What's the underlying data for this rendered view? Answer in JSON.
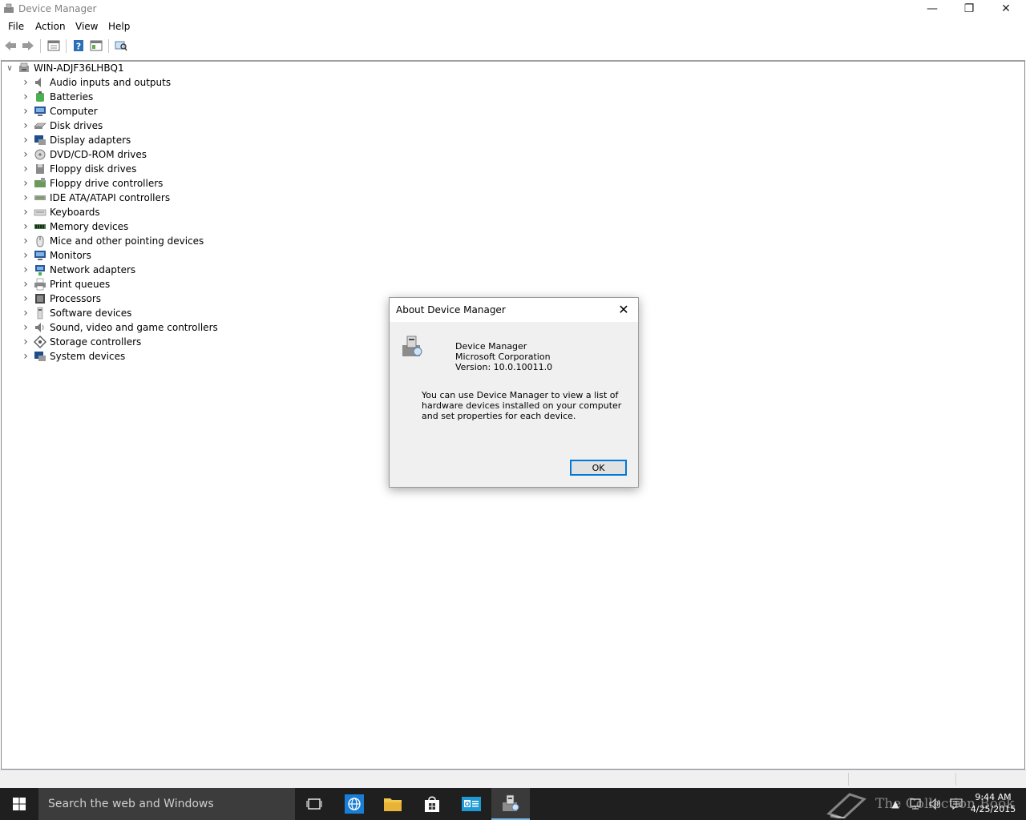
{
  "window": {
    "title": "Device Manager",
    "controls": {
      "minimize": "—",
      "restore": "❐",
      "close": "✕"
    }
  },
  "menu": [
    "File",
    "Action",
    "View",
    "Help"
  ],
  "toolbar": [
    "back-icon",
    "forward-icon",
    "properties-icon",
    "help-icon",
    "update-driver-icon",
    "scan-hardware-icon"
  ],
  "tree": {
    "root": "WIN-ADJF36LHBQ1",
    "items": [
      {
        "label": "Audio inputs and outputs",
        "icon": "speaker-icon"
      },
      {
        "label": "Batteries",
        "icon": "battery-icon"
      },
      {
        "label": "Computer",
        "icon": "computer-icon"
      },
      {
        "label": "Disk drives",
        "icon": "disk-drive-icon"
      },
      {
        "label": "Display adapters",
        "icon": "display-adapter-icon"
      },
      {
        "label": "DVD/CD-ROM drives",
        "icon": "dvd-icon"
      },
      {
        "label": "Floppy disk drives",
        "icon": "floppy-disk-icon"
      },
      {
        "label": "Floppy drive controllers",
        "icon": "floppy-controller-icon"
      },
      {
        "label": "IDE ATA/ATAPI controllers",
        "icon": "ide-controller-icon"
      },
      {
        "label": "Keyboards",
        "icon": "keyboard-icon"
      },
      {
        "label": "Memory devices",
        "icon": "memory-icon"
      },
      {
        "label": "Mice and other pointing devices",
        "icon": "mouse-icon"
      },
      {
        "label": "Monitors",
        "icon": "monitor-icon"
      },
      {
        "label": "Network adapters",
        "icon": "network-adapter-icon"
      },
      {
        "label": "Print queues",
        "icon": "printer-icon"
      },
      {
        "label": "Processors",
        "icon": "processor-icon"
      },
      {
        "label": "Software devices",
        "icon": "software-device-icon"
      },
      {
        "label": "Sound, video and game controllers",
        "icon": "sound-icon"
      },
      {
        "label": "Storage controllers",
        "icon": "storage-controller-icon"
      },
      {
        "label": "System devices",
        "icon": "system-device-icon"
      }
    ]
  },
  "dialog": {
    "title": "About Device Manager",
    "app_name": "Device Manager",
    "company": "Microsoft Corporation",
    "version": "Version: 10.0.10011.0",
    "description": "You can use Device Manager to view a list of hardware devices installed on your computer and set properties for each device.",
    "ok_label": "OK"
  },
  "taskbar": {
    "search_placeholder": "Search the web and Windows",
    "apps": [
      "task-view-icon",
      "internet-explorer-icon",
      "file-explorer-icon",
      "store-icon",
      "outlook-icon",
      "device-manager-icon"
    ],
    "time": "9:44 AM",
    "date": "4/25/2015",
    "watermark": "The Collection Book"
  },
  "colors": {
    "accent": "#0078d7",
    "taskbar": "#1f1f1f"
  }
}
